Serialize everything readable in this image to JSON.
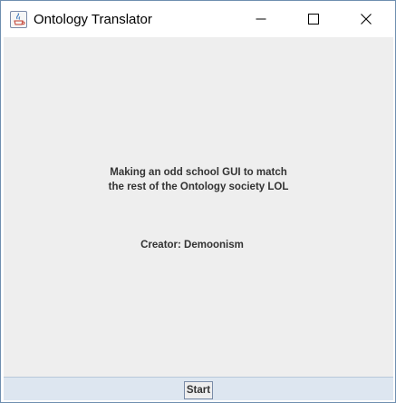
{
  "window": {
    "title": "Ontology Translator",
    "app_icon": "java-cup-icon",
    "controls": {
      "minimize_icon": "minimize-icon",
      "maximize_icon": "maximize-icon",
      "close_icon": "close-icon"
    }
  },
  "content": {
    "description_line1": "Making an odd school GUI to match",
    "description_line2": "the rest of the Ontology society LOL",
    "creator": "Creator: Demoonism"
  },
  "footer": {
    "start_label": "Start"
  },
  "colors": {
    "content_bg": "#eeeeee",
    "text": "#333333",
    "footer_bg": "#dde6f0",
    "window_border": "#6f8fb0"
  }
}
